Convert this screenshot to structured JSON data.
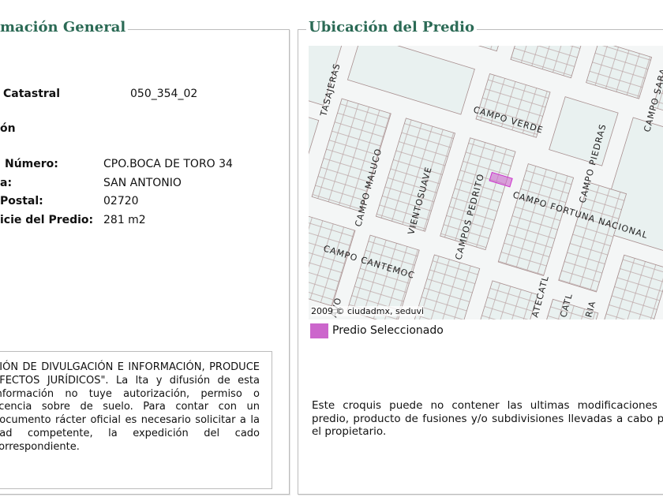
{
  "left_panel": {
    "legend": "mación General",
    "rows": [
      {
        "label": "Catastral",
        "value": "050_354_02"
      },
      {
        "label": "ón",
        "value": ""
      },
      {
        "label": "Número:",
        "value": "CPO.BOCA DE TORO 34"
      },
      {
        "label": "a:",
        "value": "SAN ANTONIO"
      },
      {
        "label": "Postal:",
        "value": "02720"
      },
      {
        "label": "icie del Predio:",
        "value": "281 m2"
      }
    ],
    "disclaimer": "SIÓN DE DIVULGACIÓN E INFORMACIÓN, PRODUCE EFECTOS JURÍDICOS\". La lta y difusión de esta información no tuye autorización, permiso o licencia sobre de suelo. Para contar con un documento rácter oficial es necesario solicitar a la dad competente, la expedición del cado correspondiente."
  },
  "right_panel": {
    "legend": "Ubicación del Predio",
    "map": {
      "copyright": "2009 © ciudadmx, seduvi",
      "streets": [
        "TASAJERAS",
        "CAMPO VERDE",
        "CAMPO SABA",
        "CAMPO PIEDRAS",
        "CAMPO MALUCO",
        "VIENTOSUAVE",
        "CAMPOS PEDRITO",
        "CAMPO FORTUNA NACIONAL",
        "CAMPO CANTEMOC",
        "AVO",
        "ATECATL",
        "CATL",
        "RIA"
      ],
      "highlight_color": "#cc66cc"
    },
    "legend_item": "Predio Seleccionado",
    "note": "Este croquis puede no contener las ultimas modificaciones al predio, producto de fusiones y/o subdivisiones llevadas a cabo por el propietario."
  }
}
